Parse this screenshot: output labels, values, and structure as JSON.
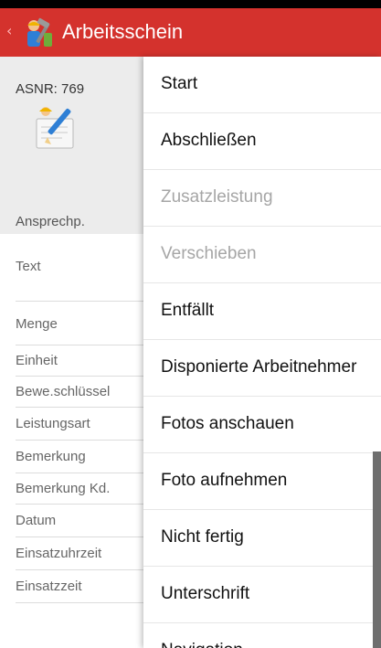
{
  "appbar": {
    "title": "Arbeitsschein",
    "back_glyph": "‹",
    "back_icon": "back-arrow-icon",
    "logo_icon": "worker-tools-logo-icon",
    "color": "#d4322d"
  },
  "detail": {
    "asnr": "ASNR: 769",
    "document_icon": "document-pencil-icon",
    "contact_label": "Ansprechp.",
    "fields": [
      "Text",
      "Menge",
      "Einheit",
      "Bewe.schlüssel",
      "Leistungsart",
      "Bemerkung",
      "Bemerkung Kd.",
      "Datum",
      "Einsatzuhrzeit",
      "Einsatzzeit"
    ]
  },
  "menu": {
    "items": [
      {
        "label": "Start",
        "enabled": true
      },
      {
        "label": "Abschließen",
        "enabled": true
      },
      {
        "label": "Zusatzleistung",
        "enabled": false
      },
      {
        "label": "Verschieben",
        "enabled": false
      },
      {
        "label": "Entfällt",
        "enabled": true
      },
      {
        "label": "Disponierte Arbeitnehmer",
        "enabled": true
      },
      {
        "label": "Fotos anschauen",
        "enabled": true
      },
      {
        "label": "Foto aufnehmen",
        "enabled": true
      },
      {
        "label": "Nicht fertig",
        "enabled": true
      },
      {
        "label": "Unterschrift",
        "enabled": true
      },
      {
        "label": "Navigation",
        "enabled": true
      }
    ],
    "enabled_color": "#111111",
    "disabled_color": "#a6a6a6"
  }
}
